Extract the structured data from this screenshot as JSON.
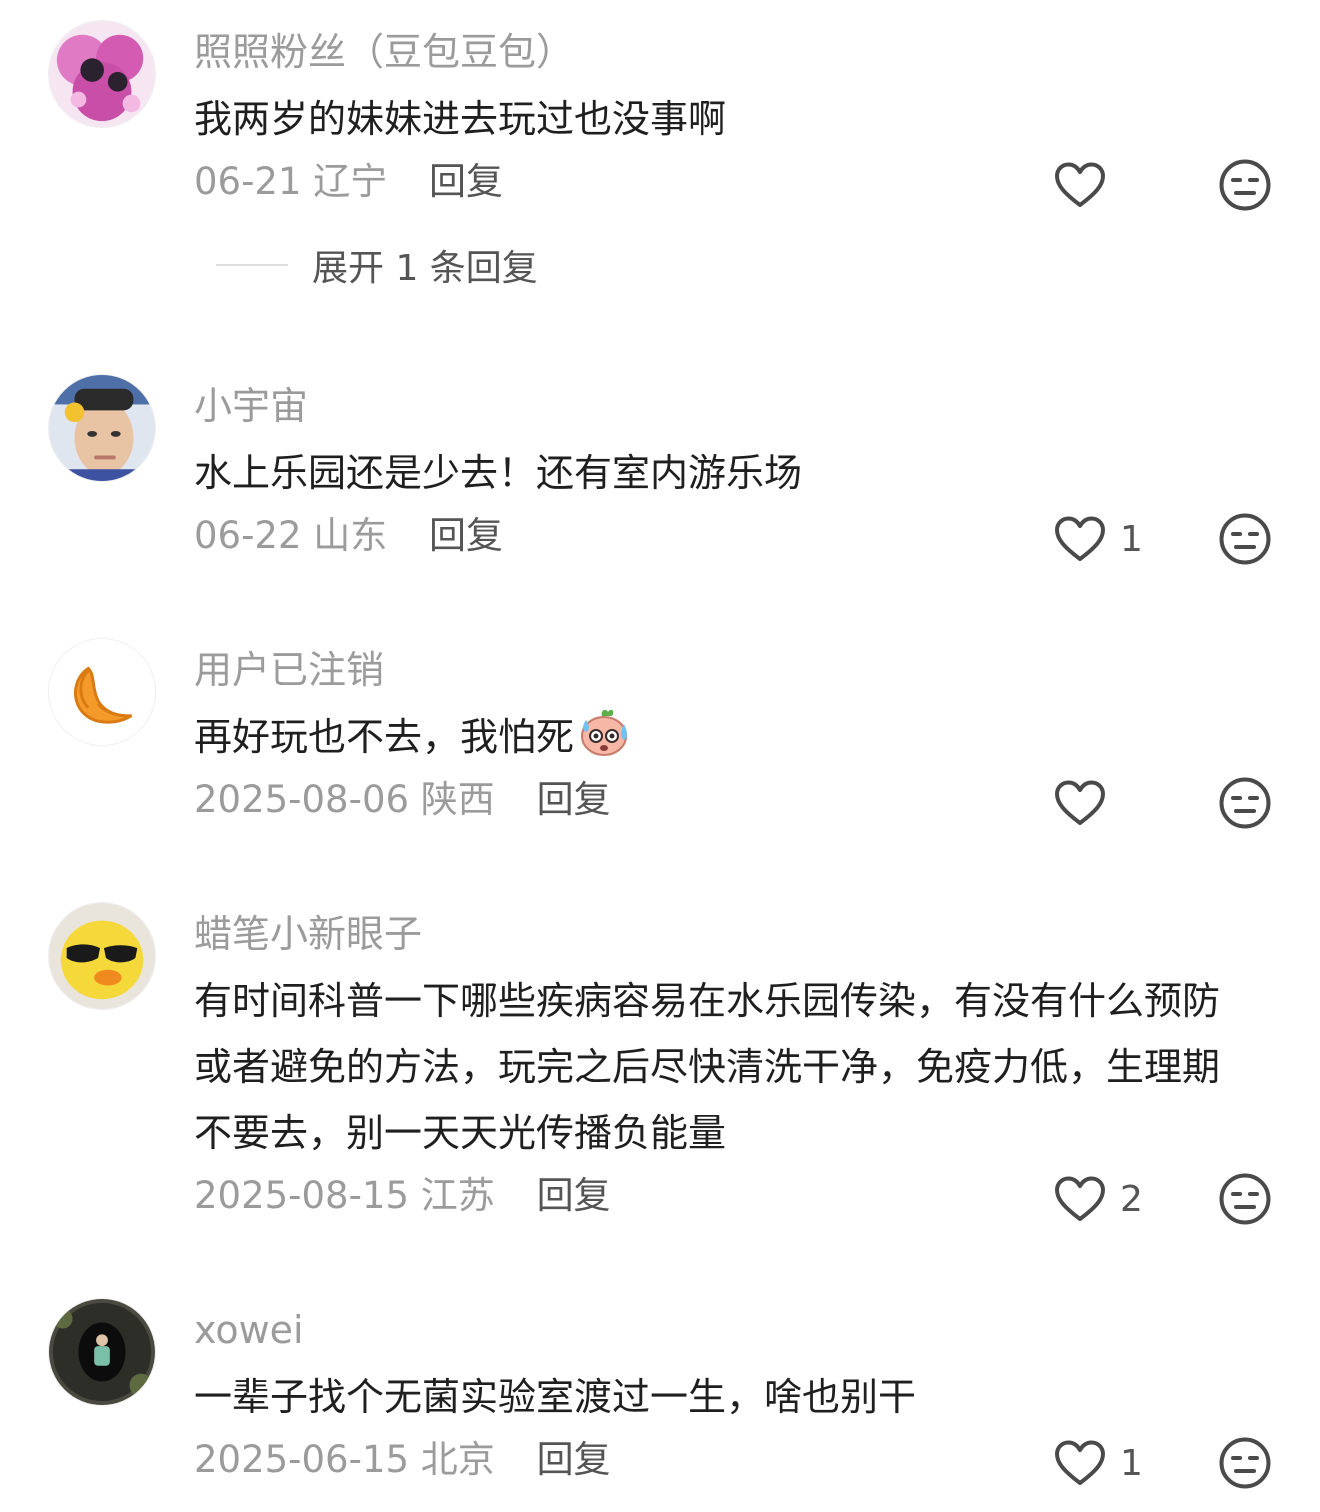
{
  "comments": [
    {
      "username": "照照粉丝（豆包豆包）",
      "content": "我两岁的妹妹进去玩过也没事啊",
      "date": "06-21",
      "location": "辽宁",
      "reply_label": "回复",
      "likes": "",
      "expand_label": "展开 1 条回复"
    },
    {
      "username": "小宇宙",
      "content": "水上乐园还是少去！还有室内游乐场",
      "date": "06-22",
      "location": "山东",
      "reply_label": "回复",
      "likes": "1"
    },
    {
      "username": "用户已注销",
      "content": "再好玩也不去，我怕死",
      "date": "2025-08-06",
      "location": "陕西",
      "reply_label": "回复",
      "likes": ""
    },
    {
      "username": "蜡笔小新眼子",
      "content": "有时间科普一下哪些疾病容易在水乐园传染，有没有什么预防或者避免的方法，玩完之后尽快清洗干净，免疫力低，生理期不要去，别一天天光传播负能量",
      "date": "2025-08-15",
      "location": "江苏",
      "reply_label": "回复",
      "likes": "2"
    },
    {
      "username": "xowei",
      "content": "一辈子找个无菌实验室渡过一生，啥也别干",
      "date": "2025-06-15",
      "location": "北京",
      "reply_label": "回复",
      "likes": "1"
    }
  ],
  "icons": {
    "like": "heart-outline-icon",
    "dislike": "neutral-face-icon",
    "emoji": "sweating-face-emoji"
  },
  "colors": {
    "username": "#9b9b9b",
    "content": "#1f1f1f",
    "meta": "#9b9b9b",
    "reply": "#555555",
    "icon": "#4a4a4a"
  }
}
